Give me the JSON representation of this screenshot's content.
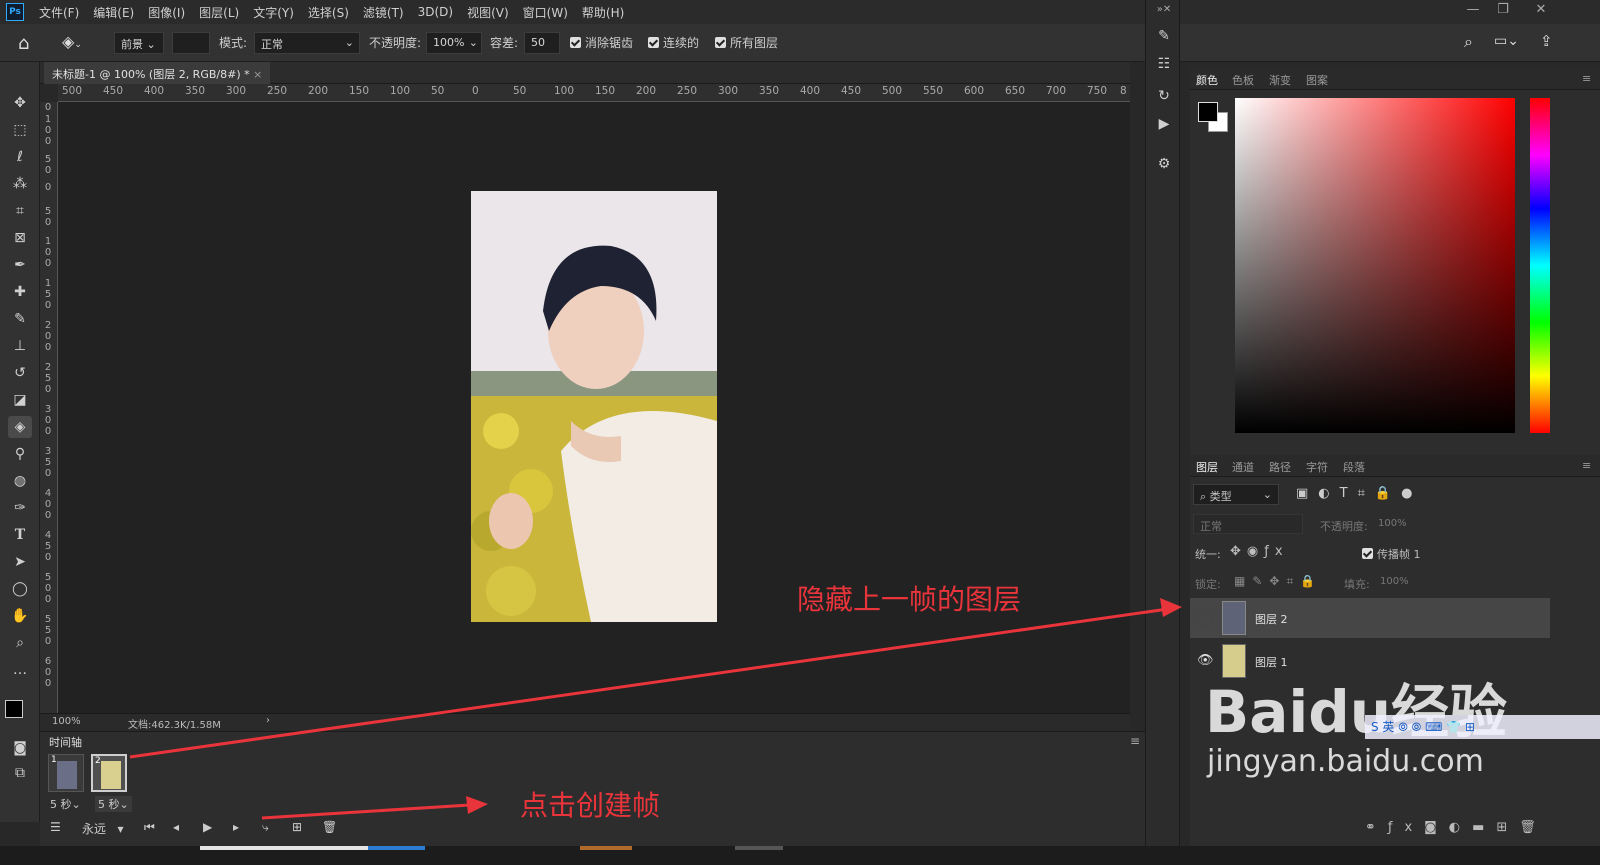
{
  "app": {
    "logo": "Ps",
    "menus": [
      "文件(F)",
      "编辑(E)",
      "图像(I)",
      "图层(L)",
      "文字(Y)",
      "选择(S)",
      "滤镜(T)",
      "3D(D)",
      "视图(V)",
      "窗口(W)",
      "帮助(H)"
    ]
  },
  "options": {
    "fill_source": "前景",
    "mode_label": "模式:",
    "mode_value": "正常",
    "opacity_label": "不透明度:",
    "opacity_value": "100%",
    "tolerance_label": "容差:",
    "tolerance_value": "50",
    "antialias": "消除锯齿",
    "contiguous": "连续的",
    "all_layers": "所有图层"
  },
  "document": {
    "tab_title": "未标题-1 @ 100% (图层 2, RGB/8#) *",
    "ruler_h": [
      "500",
      "450",
      "400",
      "350",
      "300",
      "250",
      "200",
      "150",
      "100",
      "50",
      "0",
      "50",
      "100",
      "150",
      "200",
      "250",
      "300",
      "350",
      "400",
      "450",
      "500",
      "550",
      "600",
      "650",
      "700",
      "750",
      "8"
    ],
    "ruler_v": [
      "0",
      "1 0 0",
      "5 0",
      "0",
      "5 0",
      "1 0 0",
      "1 5 0",
      "2 0 0",
      "2 5 0",
      "3 0 0",
      "3 5 0",
      "4 0 0",
      "4 5 0",
      "5 0 0",
      "5 5 0",
      "6 0 0"
    ],
    "zoom": "100%",
    "doc_info": "文档:462.3K/1.58M"
  },
  "timeline": {
    "title": "时间轴",
    "frames": [
      {
        "num": "1",
        "duration": "5 秒"
      },
      {
        "num": "2",
        "duration": "5 秒"
      }
    ],
    "loop": "永远"
  },
  "color_panel": {
    "tabs": [
      "颜色",
      "色板",
      "渐变",
      "图案"
    ]
  },
  "layers_panel": {
    "tabs": [
      "图层",
      "通道",
      "路径",
      "字符",
      "段落"
    ],
    "filter_type": "类型",
    "blend_mode": "正常",
    "opacity_label": "不透明度:",
    "opacity_value": "100%",
    "unify_label": "统一:",
    "propagate_label": "传播帧 1",
    "lock_label": "锁定:",
    "fill_label": "填充:",
    "fill_value": "100%",
    "layers": [
      {
        "name": "图层 2",
        "visible": false
      },
      {
        "name": "图层 1",
        "visible": true
      }
    ]
  },
  "annotations": {
    "hide_layer": "隐藏上一帧的图层",
    "create_frame": "点击创建帧"
  },
  "watermark": {
    "brand": "Baidu经验",
    "url": "jingyan.baidu.com"
  },
  "colors": {
    "annotation": "#e8343a",
    "app_bg": "#282828",
    "panel_bg": "#2d2d2d"
  }
}
